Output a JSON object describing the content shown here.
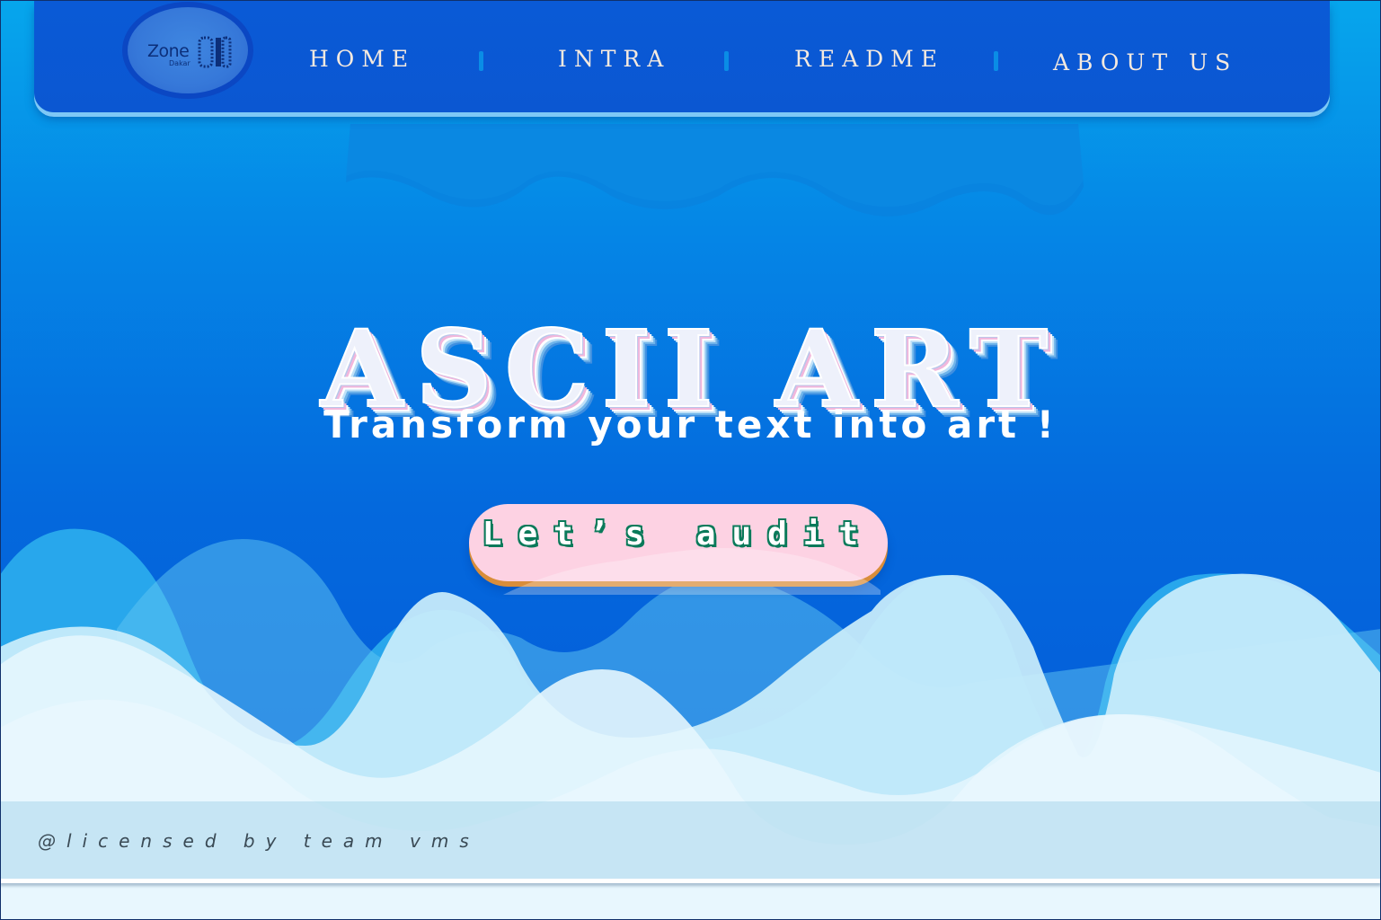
{
  "nav": {
    "logo": {
      "word": "Zone",
      "sub": "Dakar",
      "icon": "zone01-logo"
    },
    "items": [
      {
        "label": "HOME"
      },
      {
        "label": "INTRA"
      },
      {
        "label": "README"
      },
      {
        "label": "ABOUT US"
      }
    ]
  },
  "hero": {
    "title": "ASCII ART",
    "subtitle": "Transform your text into art !",
    "cta_label": "Let’s audit"
  },
  "footer": {
    "license": "@licensed by team vms"
  },
  "colors": {
    "background_top": "#06a6ec",
    "background_bottom": "#0456d8",
    "nav": "#0b57d2",
    "cta": "#fdd2e3",
    "cta_shadow": "#d98d3a"
  }
}
